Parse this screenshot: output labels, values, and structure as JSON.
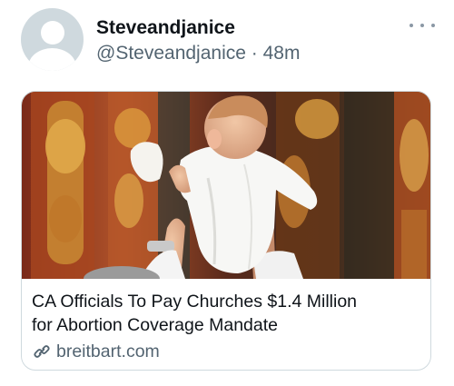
{
  "tweet": {
    "author": {
      "display_name": "Steveandjanice",
      "handle": "@Steveandjanice",
      "separator": "·",
      "timestamp": "48m"
    },
    "more_icon": "more-horizontal-icon",
    "card": {
      "image_icon": "image",
      "title_line1": "CA Officials To Pay Churches $1.4 Million",
      "title_line2": "for Abortion Coverage Mandate",
      "domain": "breitbart.com",
      "link_icon": "link-icon"
    }
  },
  "colors": {
    "text_primary": "#0f1419",
    "text_secondary": "#536471",
    "border": "#cfd9de",
    "avatar_placeholder": "#cfd9de"
  }
}
